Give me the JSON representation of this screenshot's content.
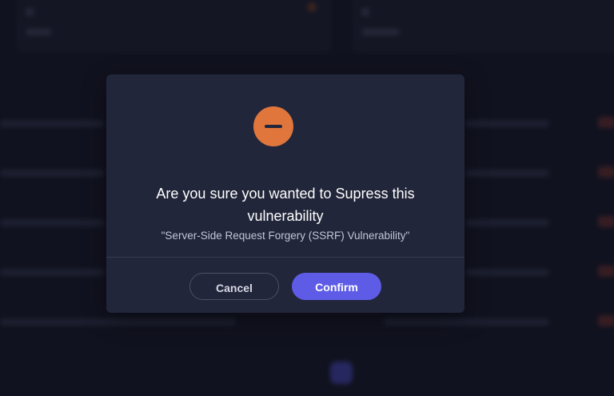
{
  "dialog": {
    "title": "Are you sure you wanted to Supress this vulnerability",
    "subtitle": "\"Server-Side Request Forgery (SSRF) Vulnerability\"",
    "cancel_label": "Cancel",
    "confirm_label": "Confirm",
    "icon": "minus-circle-icon",
    "icon_color": "#e0763c",
    "confirm_color": "#5e5ce6"
  }
}
